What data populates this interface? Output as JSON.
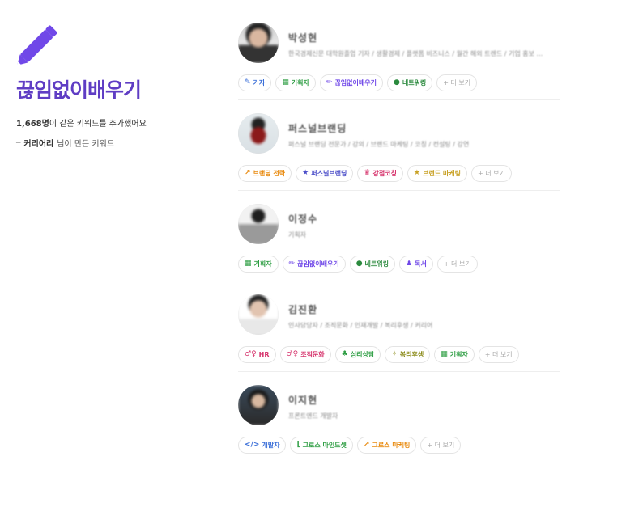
{
  "keyword": {
    "title": "끊임없이배우기",
    "count": "1,668명",
    "count_suffix": "이 같은 키워드를 추가했어요",
    "maker_name": "커리어리",
    "maker_suffix": " 님이 만든 키워드",
    "accent_color": "#5f3dc4"
  },
  "more_label": "+ 더 보기",
  "cards": [
    {
      "name": "박성현",
      "bio": "한국경제신문 대학원졸업 기자 / 생활경제 / 플랫폼 비즈니스 / 월간 해외 트렌드 / 기업 홍보 ...",
      "tags": [
        {
          "icon": "pen-icon",
          "glyph": "✎",
          "label": "기자",
          "color": "c-blue"
        },
        {
          "icon": "money-icon",
          "glyph": "▦",
          "label": "기획자",
          "color": "c-green"
        },
        {
          "icon": "pencil-icon",
          "glyph": "✏",
          "label": "끊임없이배우기",
          "color": "c-purple"
        },
        {
          "icon": "chat-icon",
          "glyph": "●",
          "label": "네트워킹",
          "color": "c-teal"
        }
      ]
    },
    {
      "name": "퍼스널브랜딩",
      "bio": "퍼스널 브랜딩 전문가 / 강의 / 브랜드 마케팅 / 코칭 / 컨설팅 / 강연",
      "tags": [
        {
          "icon": "trend-icon",
          "glyph": "↗",
          "label": "브랜딩 전략",
          "color": "c-orange"
        },
        {
          "icon": "star-icon",
          "glyph": "★",
          "label": "퍼스널브랜딩",
          "color": "c-navy"
        },
        {
          "icon": "crown-icon",
          "glyph": "♛",
          "label": "강점코칭",
          "color": "c-red"
        },
        {
          "icon": "star-icon",
          "glyph": "★",
          "label": "브랜드 마케팅",
          "color": "c-gold"
        }
      ]
    },
    {
      "name": "이정수",
      "bio": "기획자",
      "tags": [
        {
          "icon": "money-icon",
          "glyph": "▦",
          "label": "기획자",
          "color": "c-green"
        },
        {
          "icon": "pencil-icon",
          "glyph": "✏",
          "label": "끊임없이배우기",
          "color": "c-purple"
        },
        {
          "icon": "chat-icon",
          "glyph": "●",
          "label": "네트워킹",
          "color": "c-teal"
        },
        {
          "icon": "reading-icon",
          "glyph": "♟",
          "label": "독서",
          "color": "c-purple"
        }
      ]
    },
    {
      "name": "김진환",
      "bio": "인사담당자 / 조직문화 / 인재개발 / 복리후생 / 커리어",
      "tags": [
        {
          "icon": "people-icon",
          "glyph": "♂♀",
          "label": "HR",
          "color": "c-red"
        },
        {
          "icon": "people-icon",
          "glyph": "♂♀",
          "label": "조직문화",
          "color": "c-red"
        },
        {
          "icon": "tree-icon",
          "glyph": "♣",
          "label": "심리상담",
          "color": "c-green"
        },
        {
          "icon": "wand-icon",
          "glyph": "✧",
          "label": "복리후생",
          "color": "c-olive"
        },
        {
          "icon": "money-icon",
          "glyph": "▦",
          "label": "기획자",
          "color": "c-green"
        }
      ]
    },
    {
      "name": "이지현",
      "bio": "프론트엔드 개발자",
      "tags": [
        {
          "icon": "code-icon",
          "glyph": "</>",
          "label": "개발자",
          "color": "c-blue"
        },
        {
          "icon": "chart-icon",
          "glyph": "⌊",
          "label": "그로스 마인드셋",
          "color": "c-green"
        },
        {
          "icon": "trend-icon",
          "glyph": "↗",
          "label": "그로스 마케팅",
          "color": "c-orange"
        }
      ]
    }
  ]
}
